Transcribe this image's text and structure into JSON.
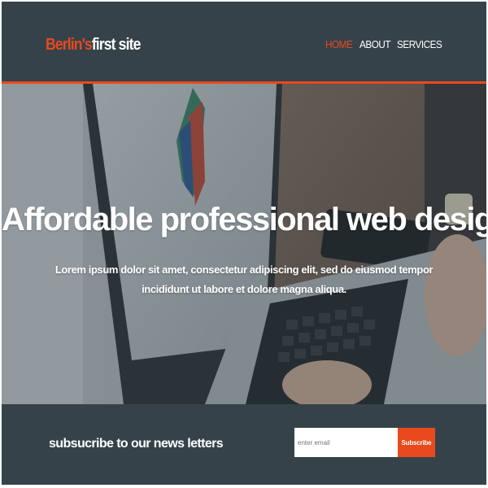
{
  "header": {
    "logo_accent": "Berlin's",
    "logo_rest": "first site",
    "nav": {
      "home": "HOME",
      "about": "ABOUT",
      "services": "SERVICES"
    }
  },
  "showcase": {
    "title": "Affordable professional web design",
    "text": "Lorem ipsum dolor sit amet, consectetur adipiscing elit, sed do eiusmod tempor incididunt ut labore et dolore magna aliqua."
  },
  "newsletter": {
    "heading": "subsucribe to our news letters",
    "input_placeholder": "enter email",
    "button_label": "Subscribe"
  },
  "colors": {
    "header_bg": "#35424a",
    "accent": "#e8491d",
    "text_light": "#ffffff"
  }
}
